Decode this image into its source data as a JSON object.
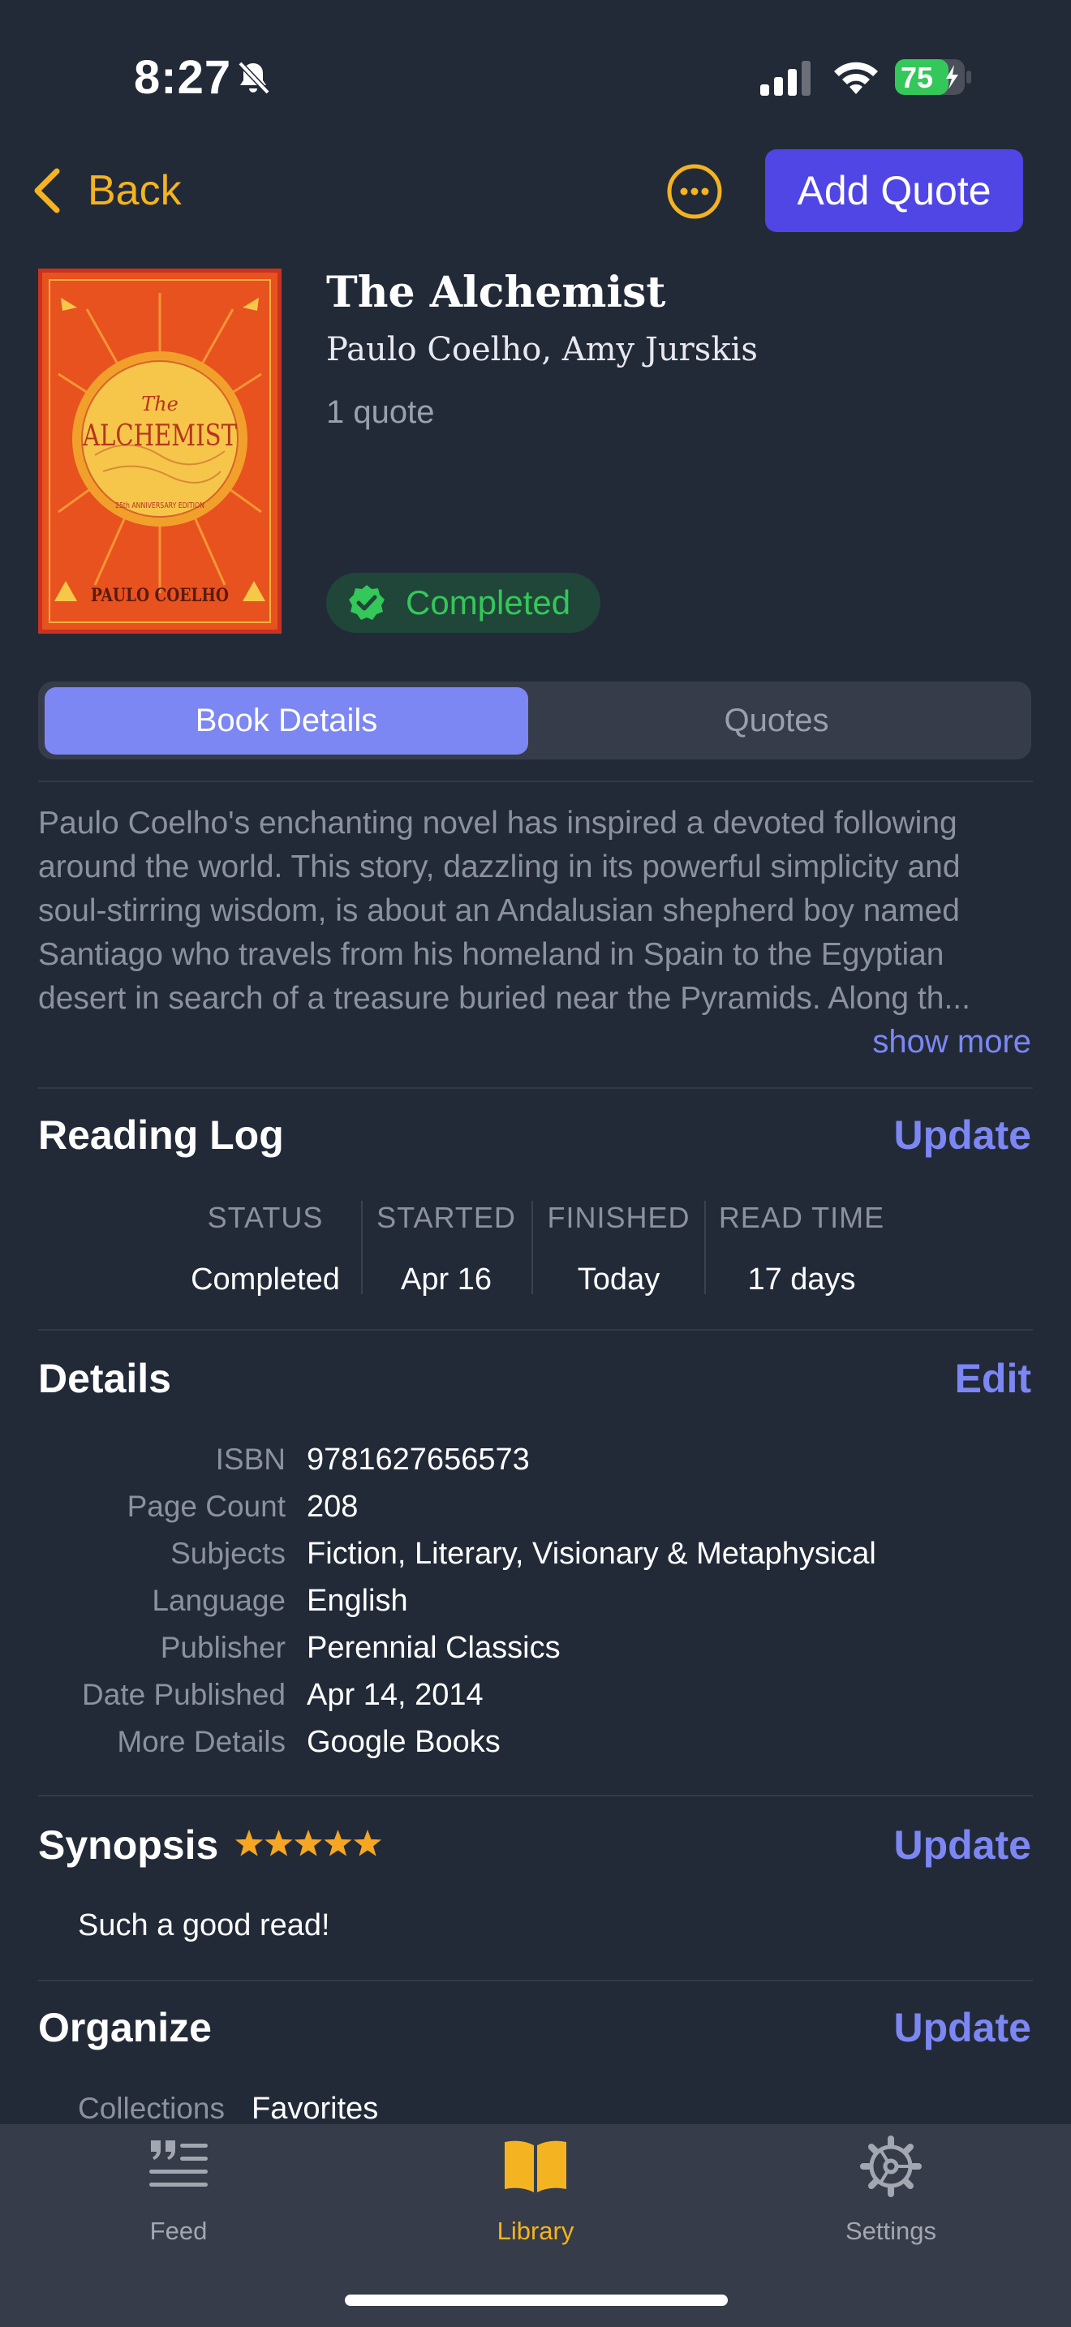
{
  "status_bar": {
    "time": "8:27",
    "battery": "75"
  },
  "nav": {
    "back_label": "Back",
    "add_quote_label": "Add Quote"
  },
  "book": {
    "title": "The Alchemist",
    "authors": "Paulo Coelho, Amy Jurskis",
    "quote_count": "1 quote",
    "status_badge": "Completed",
    "cover": {
      "line1": "The",
      "line2": "ALCHEMIST",
      "author": "PAULO COELHO",
      "edition": "25th ANNIVERSARY EDITION"
    }
  },
  "tabs": [
    {
      "label": "Book Details",
      "selected": true
    },
    {
      "label": "Quotes",
      "selected": false
    }
  ],
  "description": {
    "text": "Paulo Coelho's enchanting novel has inspired a devoted following around the world. This story, dazzling in its powerful simplicity and soul-stirring wisdom, is about an Andalusian shepherd boy named Santiago who travels from his homeland in Spain to the Egyptian desert in search of a treasure buried near the Pyramids. Along th...",
    "show_more": "show more"
  },
  "reading_log": {
    "title": "Reading Log",
    "action": "Update",
    "columns": [
      {
        "label": "STATUS",
        "value": "Completed"
      },
      {
        "label": "STARTED",
        "value": "Apr 16"
      },
      {
        "label": "FINISHED",
        "value": "Today"
      },
      {
        "label": "READ TIME",
        "value": "17 days"
      }
    ]
  },
  "details": {
    "title": "Details",
    "action": "Edit",
    "rows": [
      {
        "label": "ISBN",
        "value": "9781627656573"
      },
      {
        "label": "Page Count",
        "value": "208"
      },
      {
        "label": "Subjects",
        "value": "Fiction, Literary, Visionary & Metaphysical"
      },
      {
        "label": "Language",
        "value": "English"
      },
      {
        "label": "Publisher",
        "value": "Perennial Classics"
      },
      {
        "label": "Date Published",
        "value": "Apr 14, 2014"
      },
      {
        "label": "More Details",
        "value": "Google Books"
      }
    ]
  },
  "synopsis": {
    "title": "Synopsis",
    "rating": 5,
    "action": "Update",
    "text": "Such a good read!"
  },
  "organize": {
    "title": "Organize",
    "action": "Update",
    "collections_label": "Collections",
    "collections_value": "Favorites"
  },
  "tab_bar": [
    {
      "label": "Feed",
      "icon": "quote-feed-icon",
      "active": false
    },
    {
      "label": "Library",
      "icon": "book-icon",
      "active": true
    },
    {
      "label": "Settings",
      "icon": "gear-icon",
      "active": false
    }
  ],
  "colors": {
    "background": "#222a38",
    "accent_blue": "#7c87f4",
    "button_indigo": "#4f46e5",
    "accent_yellow": "#f4b321",
    "success_green": "#34c759"
  }
}
